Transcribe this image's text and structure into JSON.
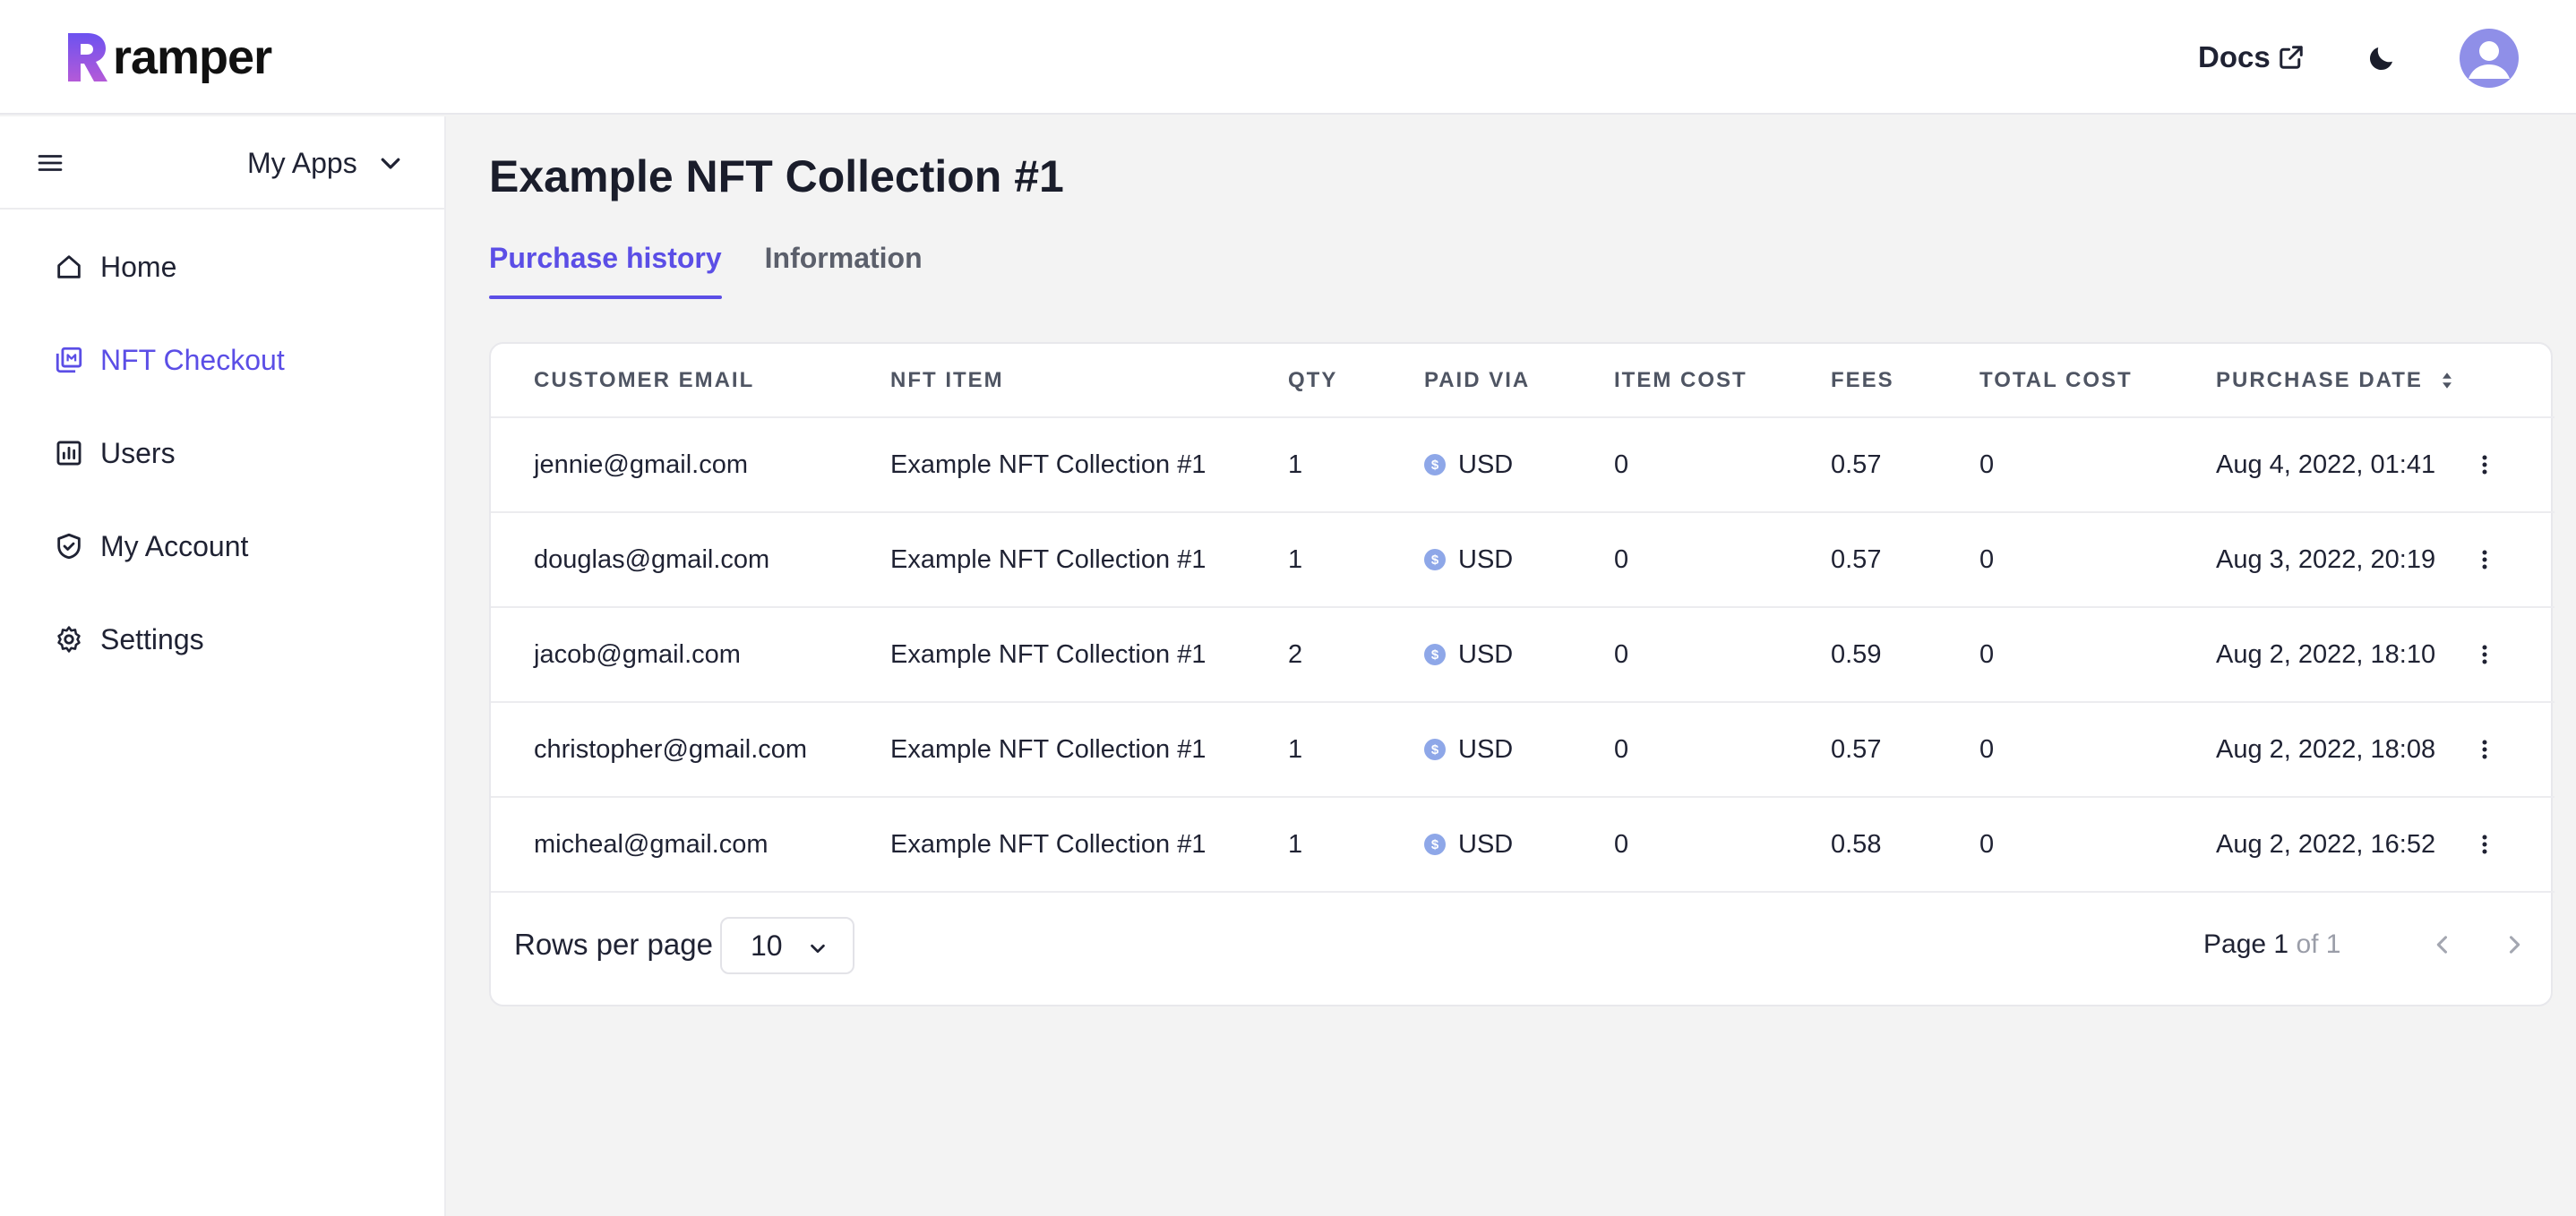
{
  "header": {
    "brand": "ramper",
    "docs_label": "Docs",
    "icons": {
      "logo": "ramper-logo",
      "external": "external-link-icon",
      "theme": "moon-icon",
      "avatar": "user-avatar-icon"
    }
  },
  "sidebar": {
    "app_selector": "My Apps",
    "items": [
      {
        "label": "Home",
        "icon": "home-icon",
        "active": false
      },
      {
        "label": "NFT Checkout",
        "icon": "nft-checkout-icon",
        "active": true
      },
      {
        "label": "Users",
        "icon": "chart-icon",
        "active": false
      },
      {
        "label": "My Account",
        "icon": "shield-check-icon",
        "active": false
      },
      {
        "label": "Settings",
        "icon": "gear-icon",
        "active": false
      }
    ]
  },
  "main": {
    "title": "Example NFT Collection #1",
    "tabs": [
      {
        "label": "Purchase history",
        "active": true
      },
      {
        "label": "Information",
        "active": false
      }
    ],
    "table": {
      "columns": [
        "CUSTOMER EMAIL",
        "NFT ITEM",
        "QTY",
        "PAID VIA",
        "ITEM COST",
        "FEES",
        "TOTAL COST",
        "PURCHASE DATE"
      ],
      "rows": [
        {
          "email": "jennie@gmail.com",
          "item": "Example NFT Collection #1",
          "qty": "1",
          "paid_via": "USD",
          "item_cost": "0",
          "fees": "0.57",
          "total_cost": "0",
          "date": "Aug 4, 2022, 01:41"
        },
        {
          "email": "douglas@gmail.com",
          "item": "Example NFT Collection #1",
          "qty": "1",
          "paid_via": "USD",
          "item_cost": "0",
          "fees": "0.57",
          "total_cost": "0",
          "date": "Aug 3, 2022, 20:19"
        },
        {
          "email": "jacob@gmail.com",
          "item": "Example NFT Collection #1",
          "qty": "2",
          "paid_via": "USD",
          "item_cost": "0",
          "fees": "0.59",
          "total_cost": "0",
          "date": "Aug 2, 2022, 18:10"
        },
        {
          "email": "christopher@gmail.com",
          "item": "Example NFT Collection #1",
          "qty": "1",
          "paid_via": "USD",
          "item_cost": "0",
          "fees": "0.57",
          "total_cost": "0",
          "date": "Aug 2, 2022, 18:08"
        },
        {
          "email": "micheal@gmail.com",
          "item": "Example NFT Collection #1",
          "qty": "1",
          "paid_via": "USD",
          "item_cost": "0",
          "fees": "0.58",
          "total_cost": "0",
          "date": "Aug 2, 2022, 16:52"
        }
      ]
    },
    "pagination": {
      "rows_label": "Rows per page",
      "rows_value": "10",
      "page_label": "Page",
      "page_current": "1",
      "page_of": "of 1"
    }
  },
  "colors": {
    "accent": "#5b4ee6",
    "coin": "#8ea7e8",
    "avatar": "#8f8fe8"
  }
}
